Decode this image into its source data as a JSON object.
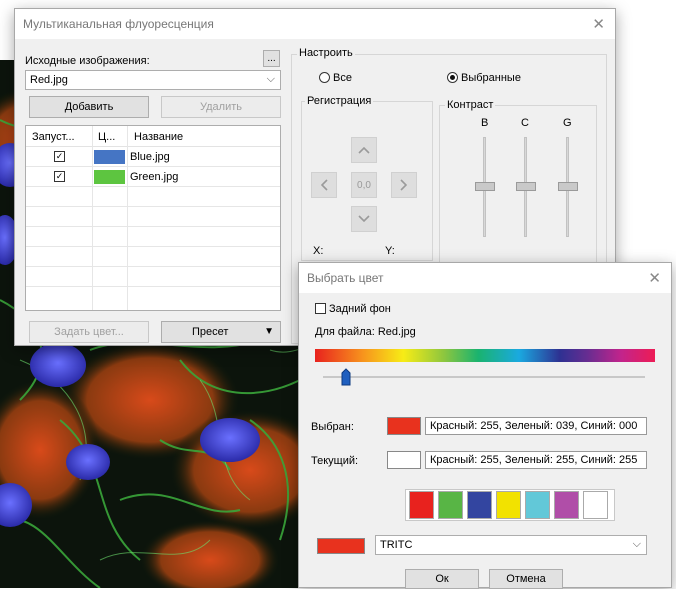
{
  "main_dialog": {
    "title": "Мультиканальная флуоресценция",
    "source_label": "Исходные изображения:",
    "browse_label": "...",
    "selected_file": "Red.jpg",
    "add_button": "Добавить",
    "delete_button": "Удалить",
    "table": {
      "headers": [
        "Запуст...",
        "Ц...",
        "Название"
      ],
      "rows": [
        {
          "checked": true,
          "color": "#4575c4",
          "name": "Blue.jpg"
        },
        {
          "checked": true,
          "color": "#5dc540",
          "name": "Green.jpg"
        }
      ]
    },
    "set_color_button": "Задать цвет...",
    "preset_button": "Пресет",
    "configure": {
      "group_title": "Настроить",
      "radio_all": "Все",
      "radio_selected": "Выбранные",
      "selected_option": "Выбранные",
      "registration": {
        "title": "Регистрация",
        "offset_value": "0,0",
        "x_label": "X:",
        "y_label": "Y:"
      },
      "contrast": {
        "title": "Контраст",
        "channels": [
          "B",
          "C",
          "G"
        ]
      }
    }
  },
  "color_dialog": {
    "title": "Выбрать цвет",
    "background_checkbox": "Задний фон",
    "for_file_label": "Для файла: Red.jpg",
    "spectrum_position": 0.07,
    "selected_label": "Выбран:",
    "selected_color": "#e8321e",
    "selected_text": "Красный: 255, Зеленый: 039, Синий: 000",
    "current_label": "Текущий:",
    "current_color": "#ffffff",
    "current_text": "Красный: 255, Зеленый: 255, Синий: 255",
    "swatches": [
      "#e8221e",
      "#58b545",
      "#3345a0",
      "#f2e200",
      "#62c8d8",
      "#b04ea8",
      "#ffffff"
    ],
    "preset_color": "#e8321e",
    "preset_name": "TRITC",
    "ok_button": "Ок",
    "cancel_button": "Отмена"
  }
}
